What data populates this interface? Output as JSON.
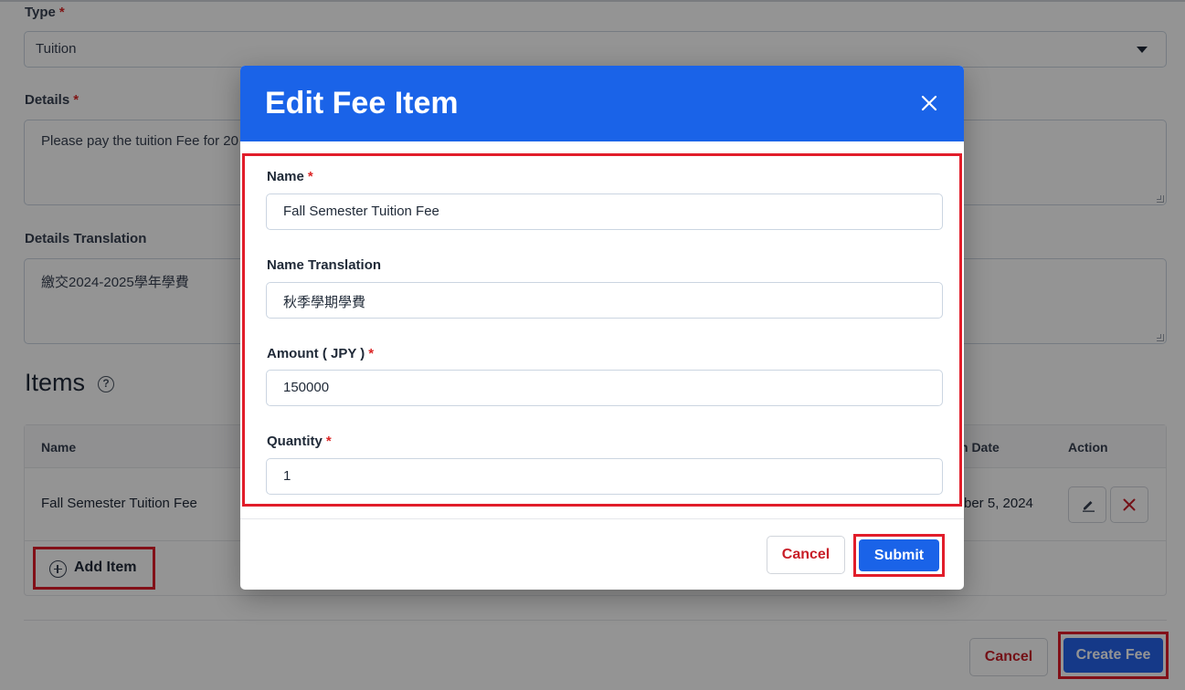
{
  "form": {
    "type_label": "Type",
    "type_value": "Tuition",
    "details_label": "Details",
    "details_value": "Please pay the tuition Fee for 20",
    "details_translation_label": "Details Translation",
    "details_translation_value": "繳交2024-2025學年學費",
    "required_mark": "*"
  },
  "items": {
    "title": "Items",
    "help_glyph": "?",
    "columns": [
      "Name",
      "n Date",
      "Action"
    ],
    "rows": [
      {
        "name": "Fall Semester Tuition Fee",
        "date": "ber 5, 2024"
      }
    ],
    "add_label": "Add Item"
  },
  "footer": {
    "cancel_label": "Cancel",
    "create_label": "Create Fee"
  },
  "modal": {
    "title": "Edit Fee Item",
    "name_label": "Name",
    "name_value": "Fall Semester Tuition Fee",
    "name_translation_label": "Name Translation",
    "name_translation_value": "秋季學期學費",
    "amount_label": "Amount ( JPY )",
    "amount_value": "150000",
    "quantity_label": "Quantity",
    "quantity_value": "1",
    "cancel_label": "Cancel",
    "submit_label": "Submit"
  },
  "colors": {
    "primary": "#1a63e8",
    "danger": "#c81e28",
    "highlight": "#e11d2a"
  }
}
